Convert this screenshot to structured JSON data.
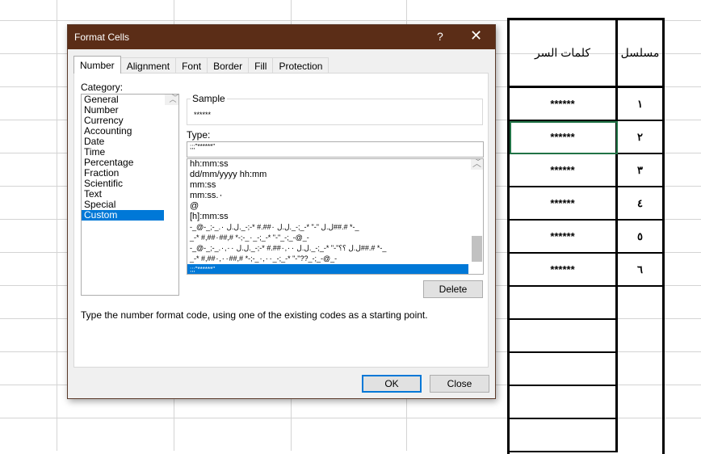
{
  "sheet": {
    "header_password": "كلمات السر",
    "header_serial": "مسلسل",
    "rows": [
      {
        "serial": "١",
        "password": "******"
      },
      {
        "serial": "٢",
        "password": "******"
      },
      {
        "serial": "٣",
        "password": "******"
      },
      {
        "serial": "٤",
        "password": "******"
      },
      {
        "serial": "٥",
        "password": "******"
      },
      {
        "serial": "٦",
        "password": "******"
      }
    ],
    "selected_row": 2
  },
  "dialog": {
    "title": "Format Cells",
    "help": "?",
    "close_icon": "✕",
    "tabs": [
      "Number",
      "Alignment",
      "Font",
      "Border",
      "Fill",
      "Protection"
    ],
    "active_tab": "Number",
    "category_label": "Category:",
    "categories": [
      "General",
      "Number",
      "Currency",
      "Accounting",
      "Date",
      "Time",
      "Percentage",
      "Fraction",
      "Scientific",
      "Text",
      "Special",
      "Custom"
    ],
    "selected_category": "Custom",
    "sample_label": "Sample",
    "sample_value": "******",
    "type_label": "Type:",
    "type_value": ";;;\"******\"",
    "formats": [
      "hh:mm:ss",
      "dd/mm/yyyy hh:mm",
      "mm:ss",
      "mm:ss.٠",
      "@",
      "[h]:mm:ss",
      "-_@-_;-_.ل.ل \"-\" *-_;-_.ل.ل ٠##.# *-;-_.ل.ل ٠##.# *-_",
      "_-* #,##٠_-;-* #,##٠_-;_-* \"-\"_-;_-@_-",
      "-_@-_;-_.ل.ل ؟؟\"-\" *-_;-_.ل.ل ٠,٠٠##.# *-;-_.ل.ل ٠,٠٠##.# *-_",
      "_-* #,##٠,٠٠_-;-* #,##٠,٠٠_-;_-* \"-\"??_-;_-@_-"
    ],
    "selected_format": ";;;\"******\"",
    "delete_label": "Delete",
    "hint": "Type the number format code, using one of the existing codes as a starting point.",
    "ok_label": "OK",
    "close_label": "Close"
  }
}
